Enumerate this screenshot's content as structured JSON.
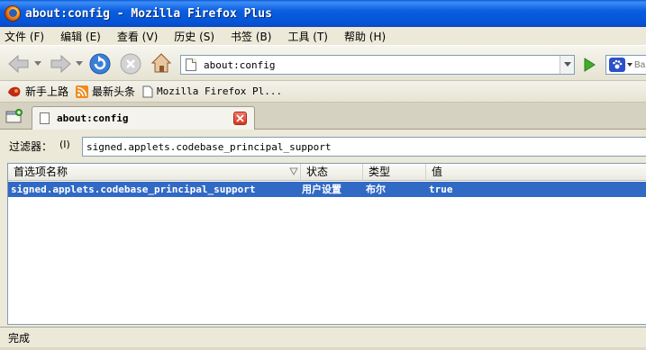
{
  "window": {
    "title": "about:config - Mozilla Firefox Plus"
  },
  "menubar": {
    "items": [
      "文件 (F)",
      "编辑 (E)",
      "查看 (V)",
      "历史 (S)",
      "书签 (B)",
      "工具 (T)",
      "帮助 (H)"
    ]
  },
  "navbar": {
    "url": "about:config",
    "search_placeholder": "Ba"
  },
  "bookmarks": {
    "items": [
      "新手上路",
      "最新头条",
      "Mozilla Firefox Pl..."
    ]
  },
  "tab": {
    "label": "about:config"
  },
  "filter": {
    "label": "过滤器：",
    "accesskey": "(I)",
    "value": "signed.applets.codebase_principal_support"
  },
  "table": {
    "columns": [
      "首选项名称",
      "状态",
      "类型",
      "值"
    ],
    "rows": [
      {
        "name": "signed.applets.codebase_principal_support",
        "status": "用户设置",
        "type": "布尔",
        "value": "true"
      }
    ]
  },
  "status": {
    "text": "完成"
  },
  "colors": {
    "titlebar": "#0a5ee0",
    "selection": "#316ac5"
  }
}
